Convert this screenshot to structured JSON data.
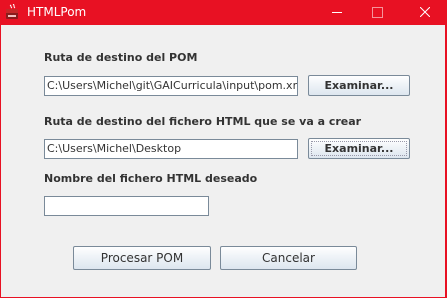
{
  "window": {
    "title": "HTMLPom",
    "icon": "java-app-icon",
    "titlebar_color": "#e81123"
  },
  "form": {
    "pom_label": "Ruta de destino del POM",
    "pom_value": "C:\\Users\\Michel\\git\\GAICurricula\\input\\pom.xml",
    "pom_browse": "Examinar...",
    "html_dest_label": "Ruta de destino del fichero HTML que se va a crear",
    "html_dest_value": "C:\\Users\\Michel\\Desktop",
    "html_dest_browse": "Examinar...",
    "html_name_label": "Nombre del fichero HTML deseado",
    "html_name_value": ""
  },
  "actions": {
    "process_label": "Procesar POM",
    "cancel_label": "Cancelar"
  }
}
